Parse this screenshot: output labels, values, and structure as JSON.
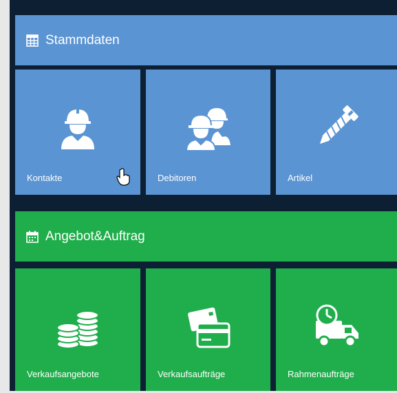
{
  "sections": [
    {
      "title": "Stammdaten",
      "icon": "table-grid-icon",
      "color": "#5b94d3",
      "tiles": [
        {
          "label": "Kontakte",
          "icon": "worker-helmet-icon"
        },
        {
          "label": "Debitoren",
          "icon": "worker-group-icon"
        },
        {
          "label": "Artikel",
          "icon": "screw-icon"
        }
      ]
    },
    {
      "title": "Angebot&Auftrag",
      "icon": "calendar-icon",
      "color": "#1fae4b",
      "tiles": [
        {
          "label": "Verkaufsangebote",
          "icon": "coins-stack-icon"
        },
        {
          "label": "Verkaufsaufträge",
          "icon": "credit-card-icon"
        },
        {
          "label": "Rahmenaufträge",
          "icon": "delivery-truck-clock-icon"
        }
      ]
    }
  ]
}
